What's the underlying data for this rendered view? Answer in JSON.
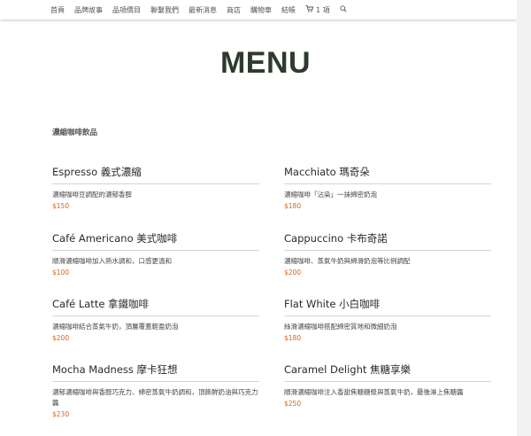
{
  "nav": {
    "items": [
      "首頁",
      "品牌故事",
      "品項價目",
      "聯繫我們",
      "最新消息",
      "商店",
      "購物車",
      "結帳"
    ],
    "cart_count": "1 項",
    "cart_icon": "cart-icon",
    "search_icon": "search-icon"
  },
  "page": {
    "title": "MENU",
    "section_title": "濃縮咖啡飲品"
  },
  "items": [
    {
      "name": "Espresso 義式濃縮",
      "desc": "濃縮咖啡豆調配的濃郁香醇",
      "price": "$150"
    },
    {
      "name": "Macchiato 瑪奇朵",
      "desc": "濃縮咖啡「沾染」一抹綿密奶泡",
      "price": "$180"
    },
    {
      "name": "Café Americano 美式咖啡",
      "desc": "順滑濃縮咖啡加入熱水調和，口感更溫和",
      "price": "$100"
    },
    {
      "name": "Cappuccino 卡布奇諾",
      "desc": "濃縮咖啡、蒸氣牛奶與綿滑奶泡等比例調配",
      "price": "$200"
    },
    {
      "name": "Café Latte 拿鐵咖啡",
      "desc": "濃縮咖啡結合蒸氣牛奶，頂層覆蓋輕盈奶泡",
      "price": "$200"
    },
    {
      "name": "Flat White 小白咖啡",
      "desc": "絲滑濃縮咖啡搭配綿密質地和微細奶泡",
      "price": "$180"
    },
    {
      "name": "Mocha Madness 摩卡狂想",
      "desc": "濃郁濃縮咖啡與香醇巧克力、綿密蒸氣牛奶調和，頂飾鮮奶油與巧克力醬",
      "price": "$230"
    },
    {
      "name": "Caramel Delight 焦糖享樂",
      "desc": "順滑濃縮咖啡注入香甜焦糖糖漿與蒸氣牛奶，最後淋上焦糖醬",
      "price": "$250"
    }
  ],
  "colors": {
    "title": "#2e3a2e",
    "price": "#e0611a",
    "divider": "#d4d4d4"
  }
}
